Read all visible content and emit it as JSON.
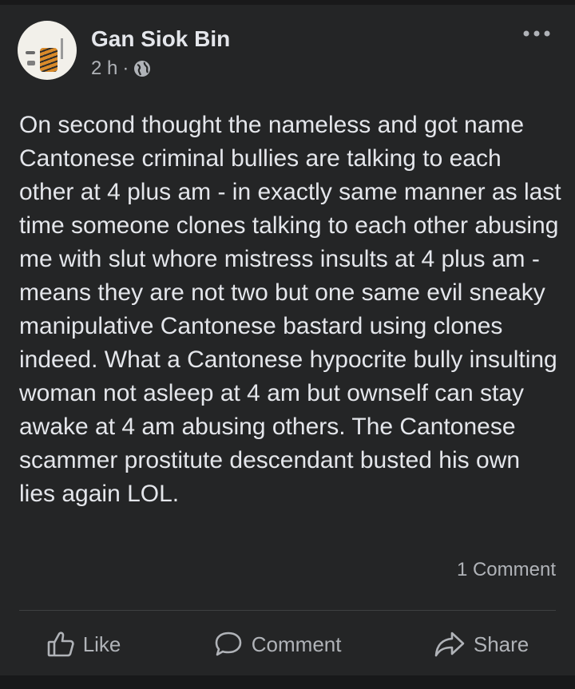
{
  "post": {
    "author": "Gan Siok Bin",
    "time": "2 h",
    "separator": "·",
    "privacy_icon": "globe-icon",
    "text": "On second thought the nameless and got name Cantonese criminal bullies are talking to each other at 4 plus am - in exactly same manner as last time someone clones talking to each other abusing me with slut whore mistress insults at 4 plus am - means they are not two but one same evil sneaky manipulative Cantonese bastard using clones indeed. What a Cantonese hypocrite bully insulting woman not asleep at 4 am but ownself can stay awake at 4 am abusing others. The Cantonese scammer prostitute descendant busted his own lies again LOL.",
    "comment_count": "1 Comment",
    "more_icon": "more-options-icon"
  },
  "actions": {
    "like_label": "Like",
    "comment_label": "Comment",
    "share_label": "Share"
  },
  "colors": {
    "background": "#242526",
    "text": "#e4e6eb",
    "secondary_text": "#b0b3b8"
  }
}
